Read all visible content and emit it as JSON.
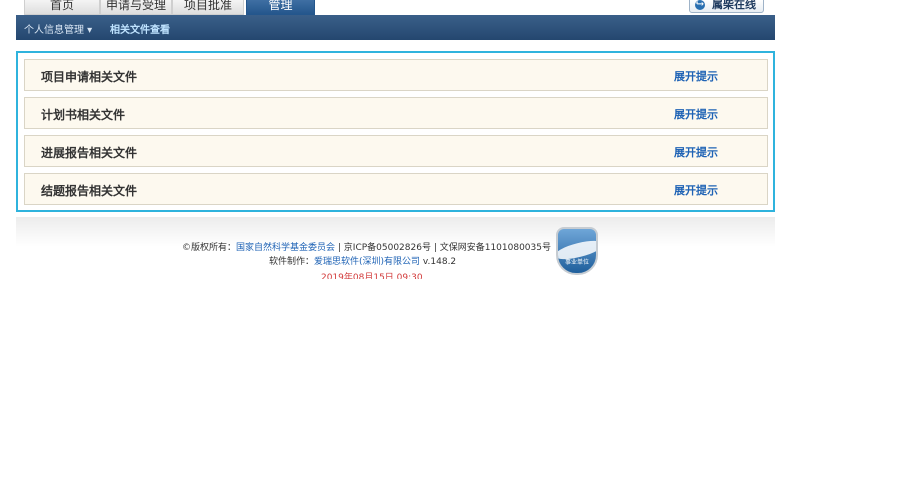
{
  "nav": {
    "tabs": [
      {
        "label": "首页"
      },
      {
        "label": "申请与受理"
      },
      {
        "label": "项目批准"
      },
      {
        "label": "管理"
      }
    ],
    "logout_label": "属柴在线"
  },
  "subnav": {
    "menu_label": "个人信息管理 ▾",
    "current_label": "相关文件查看"
  },
  "sections": [
    {
      "title": "项目申请相关文件",
      "toggle": "展开提示"
    },
    {
      "title": "计划书相关文件",
      "toggle": "展开提示"
    },
    {
      "title": "进展报告相关文件",
      "toggle": "展开提示"
    },
    {
      "title": "结题报告相关文件",
      "toggle": "展开提示"
    }
  ],
  "footer": {
    "copyright_prefix": "©版权所有：",
    "copyright_org": "国家自然科学基金委员会",
    "icp_text": " | 京ICP备05002826号 | 文保网安备1101080035号",
    "software_prefix": "软件制作：",
    "software_company": "爱瑞思软件(深圳)有限公司",
    "version": " v.148.2",
    "timestamp": "2019年08月15日 09:30",
    "badge_text": "事业单位"
  },
  "colors": {
    "accent_blue": "#2fb3dd",
    "nav_blue": "#24476f",
    "link_blue": "#1f63b5",
    "row_bg": "#fdf9ef"
  }
}
